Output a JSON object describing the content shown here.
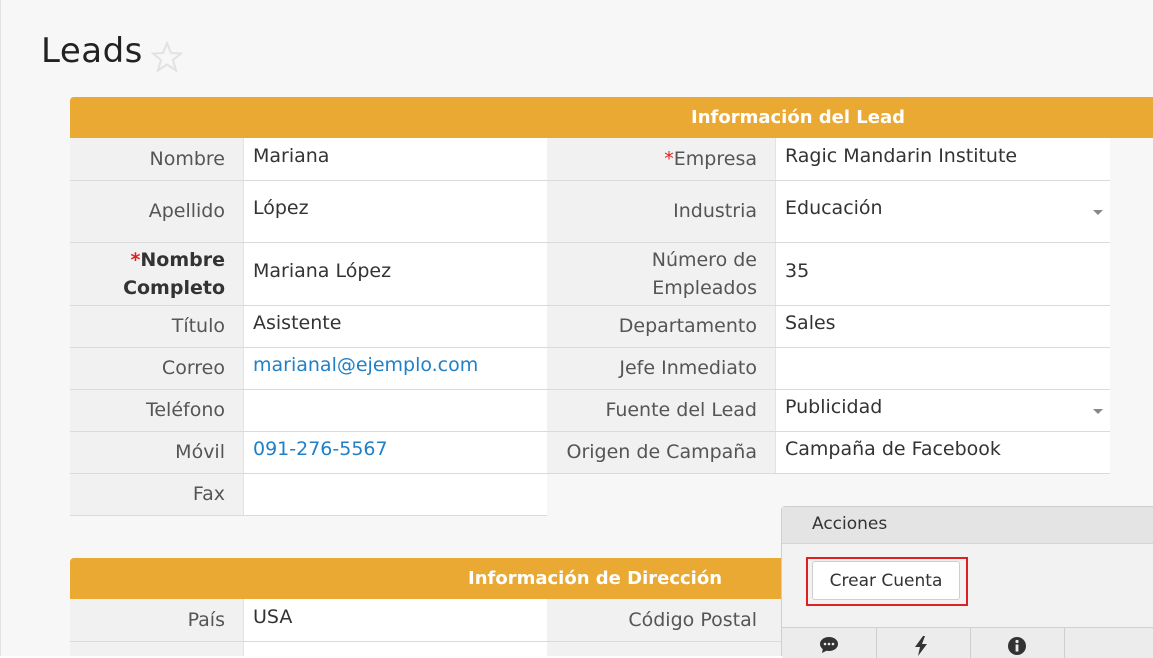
{
  "page": {
    "title": "Leads"
  },
  "lead_section": {
    "header": "Información del Lead",
    "left": [
      {
        "label": "Nombre",
        "value": "Mariana",
        "required": false,
        "bold": false,
        "link": false
      },
      {
        "label": "Apellido",
        "value": "López",
        "required": false,
        "bold": false,
        "link": false
      },
      {
        "label_line1": "Nombre",
        "label_line2": "Completo",
        "value": "Mariana López",
        "required": true,
        "bold": true,
        "link": false
      },
      {
        "label": "Título",
        "value": "Asistente",
        "required": false,
        "bold": false,
        "link": false
      },
      {
        "label": "Correo",
        "value": "marianal@ejemplo.com",
        "required": false,
        "bold": false,
        "link": true
      },
      {
        "label": "Teléfono",
        "value": "",
        "required": false,
        "bold": false,
        "link": false
      },
      {
        "label": "Móvil",
        "value": "091-276-5567",
        "required": false,
        "bold": false,
        "link": true
      },
      {
        "label": "Fax",
        "value": "",
        "required": false,
        "bold": false,
        "link": false
      }
    ],
    "right": [
      {
        "label": "Empresa",
        "value": "Ragic Mandarin Institute",
        "required": true,
        "dropdown": false
      },
      {
        "label": "Industria",
        "value": "Educación",
        "required": false,
        "dropdown": true
      },
      {
        "label_line1": "Número de",
        "label_line2": "Empleados",
        "value": "35",
        "required": false,
        "dropdown": false
      },
      {
        "label": "Departamento",
        "value": "Sales",
        "required": false,
        "dropdown": false
      },
      {
        "label": "Jefe Inmediato",
        "value": "",
        "required": false,
        "dropdown": false
      },
      {
        "label": "Fuente del Lead",
        "value": "Publicidad",
        "required": false,
        "dropdown": true
      },
      {
        "label": "Origen de Campaña",
        "value": "Campaña de Facebook",
        "required": false,
        "dropdown": false
      }
    ]
  },
  "address_section": {
    "header": "Información de Dirección",
    "left": [
      {
        "label": "País",
        "value": "USA"
      }
    ],
    "right": [
      {
        "label": "Código Postal",
        "value": ""
      }
    ]
  },
  "actions": {
    "title": "Acciones",
    "button": "Crear Cuenta",
    "tools": [
      "comment-icon",
      "bolt-icon",
      "info-icon"
    ]
  },
  "colors": {
    "header": "#e9a933",
    "link": "#1f80c8",
    "required": "#e02020",
    "highlight": "#e02020"
  }
}
